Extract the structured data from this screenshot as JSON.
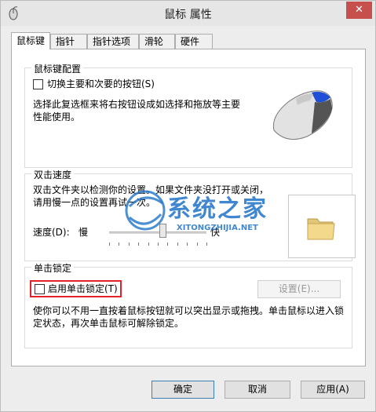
{
  "window": {
    "title": "鼠标 属性",
    "close_label": "✕"
  },
  "tabs": [
    {
      "label": "鼠标键",
      "active": true
    },
    {
      "label": "指针"
    },
    {
      "label": "指针选项"
    },
    {
      "label": "滑轮"
    },
    {
      "label": "硬件"
    }
  ],
  "button_config": {
    "title": "鼠标键配置",
    "switch_label": "切换主要和次要的按钮(S)",
    "switch_checked": false,
    "description": "选择此复选框来将右按钮设成如选择和拖放等主要性能使用。",
    "icon": "mouse-icon"
  },
  "double_click": {
    "title": "双击速度",
    "description": "双击文件夹以检测你的设置。如果文件夹没打开或关闭，请用慢一点的设置再试一次。",
    "speed_label": "速度(D):",
    "slow_label": "慢",
    "fast_label": "快",
    "speed_value_fraction": 0.55,
    "tick_count": 11,
    "icon": "folder-icon"
  },
  "click_lock": {
    "title": "单击锁定",
    "enable_label": "启用单击锁定(T)",
    "enable_checked": false,
    "settings_label": "设置(E)...",
    "description": "使你可以不用一直按着鼠标按钮就可以突出显示或拖拽。单击鼠标以进入锁定状态，再次单击鼠标可解除锁定。"
  },
  "footer": {
    "ok_label": "确定",
    "cancel_label": "取消",
    "apply_label": "应用(A)"
  },
  "watermark": {
    "text_cn": "系统之家",
    "text_en": "XITONGZHIJIA.NET"
  },
  "colors": {
    "highlight_border": "#e3232a",
    "close_button": "#c7504c",
    "watermark_blue": "#1f73c7"
  }
}
